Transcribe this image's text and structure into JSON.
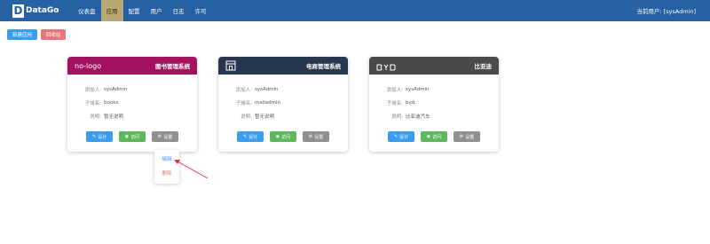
{
  "header": {
    "logo_letter": "D",
    "logo_text": "DataGo",
    "nav": [
      "仪表盘",
      "应用",
      "配置",
      "用户",
      "日志",
      "许可"
    ],
    "current_user": "当前用户: [sysAdmin]"
  },
  "toolbar": {
    "new_label": "新建应用",
    "recycle_label": "回收站"
  },
  "labels": {
    "adder": "添加人:",
    "subdomain": "子域名:",
    "desc": "说明:"
  },
  "buttons": {
    "design": "设计",
    "visit": "访问",
    "settings": "设置"
  },
  "cards": [
    {
      "logo_text": "no-logo",
      "title": "图书管理系统",
      "header_color": "#a3125e",
      "adder": "sysAdmin",
      "subdomain": "books",
      "desc": "暂无说明"
    },
    {
      "logo_icon": "store-icon",
      "title": "电商管理系统",
      "header_color": "#28374f",
      "adder": "sysAdmin",
      "subdomain": "malladmin",
      "desc": "暂无说明"
    },
    {
      "logo_icon": "byd-logo",
      "title": "比亚迪",
      "header_color": "#4a4a4a",
      "adder": "sysAdmin",
      "subdomain": "byd",
      "desc": "比亚迪汽车"
    }
  ],
  "dropdown": {
    "edit": "编辑",
    "delete": "删除"
  },
  "colors": {
    "topbar": "#2561a3",
    "active_nav": "#b8a874",
    "primary": "#3b9df0",
    "success": "#5db85c",
    "danger": "#e9767a",
    "annotation_arrow": "#d9363e"
  }
}
